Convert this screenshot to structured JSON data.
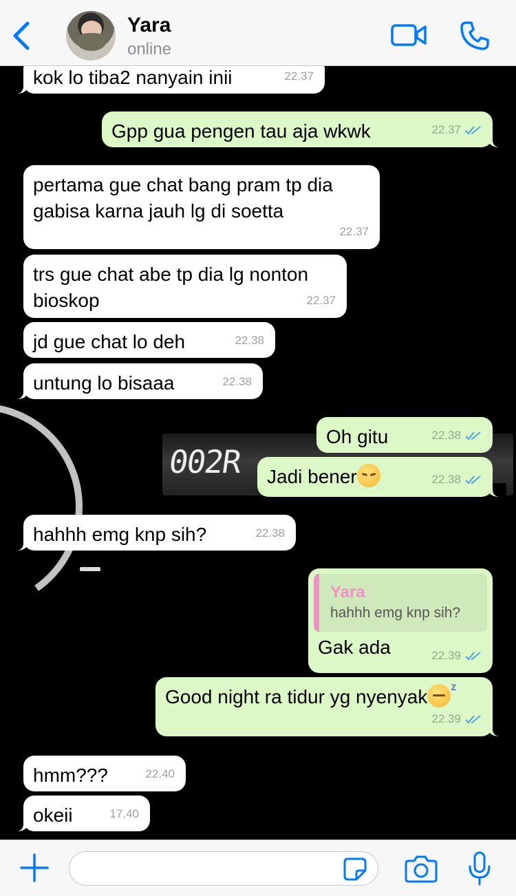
{
  "header": {
    "contact_name": "Yara",
    "status": "online",
    "accent_color": "#007aff"
  },
  "messages": [
    {
      "direction": "in",
      "text": "kok lo tiba2 nanyain inii",
      "time": "22.37"
    },
    {
      "direction": "out",
      "text": "Gpp gua pengen tau aja wkwk",
      "time": "22.37",
      "status": "read"
    },
    {
      "direction": "in",
      "text": "pertama gue chat bang pram tp dia gabisa karna jauh lg di soetta",
      "time": "22.37"
    },
    {
      "direction": "in",
      "text": "trs gue chat abe tp dia lg nonton bioskop",
      "time": "22.37"
    },
    {
      "direction": "in",
      "text": "jd gue chat lo deh",
      "time": "22.38"
    },
    {
      "direction": "in",
      "text": "untung lo bisaaa",
      "time": "22.38"
    },
    {
      "direction": "out",
      "text": "Oh gitu",
      "time": "22.38",
      "status": "read"
    },
    {
      "direction": "out",
      "text": "Jadi bener",
      "emoji": "pensive-face",
      "time": "22.38",
      "status": "read"
    },
    {
      "direction": "in",
      "text": "hahhh emg knp sih?",
      "time": "22.38"
    },
    {
      "direction": "out",
      "text": "Gak ada",
      "time": "22.39",
      "status": "read",
      "quote": {
        "name": "Yara",
        "text": "hahhh emg knp sih?"
      }
    },
    {
      "direction": "out",
      "text": "Good night ra tidur yg nyenyak",
      "emoji": "sleeping-face",
      "time": "22.39",
      "status": "read"
    },
    {
      "direction": "in",
      "text": "hmm???",
      "time": "22.40"
    },
    {
      "direction": "in",
      "text": "okeii",
      "time": "17.40"
    }
  ],
  "background": {
    "display_text": "002R"
  },
  "composer": {
    "placeholder": ""
  },
  "colors": {
    "incoming_bubble": "#ffffff",
    "outgoing_bubble": "#dcf8c6",
    "quote_accent": "#f291c6",
    "read_ticks": "#4fa3e0"
  }
}
